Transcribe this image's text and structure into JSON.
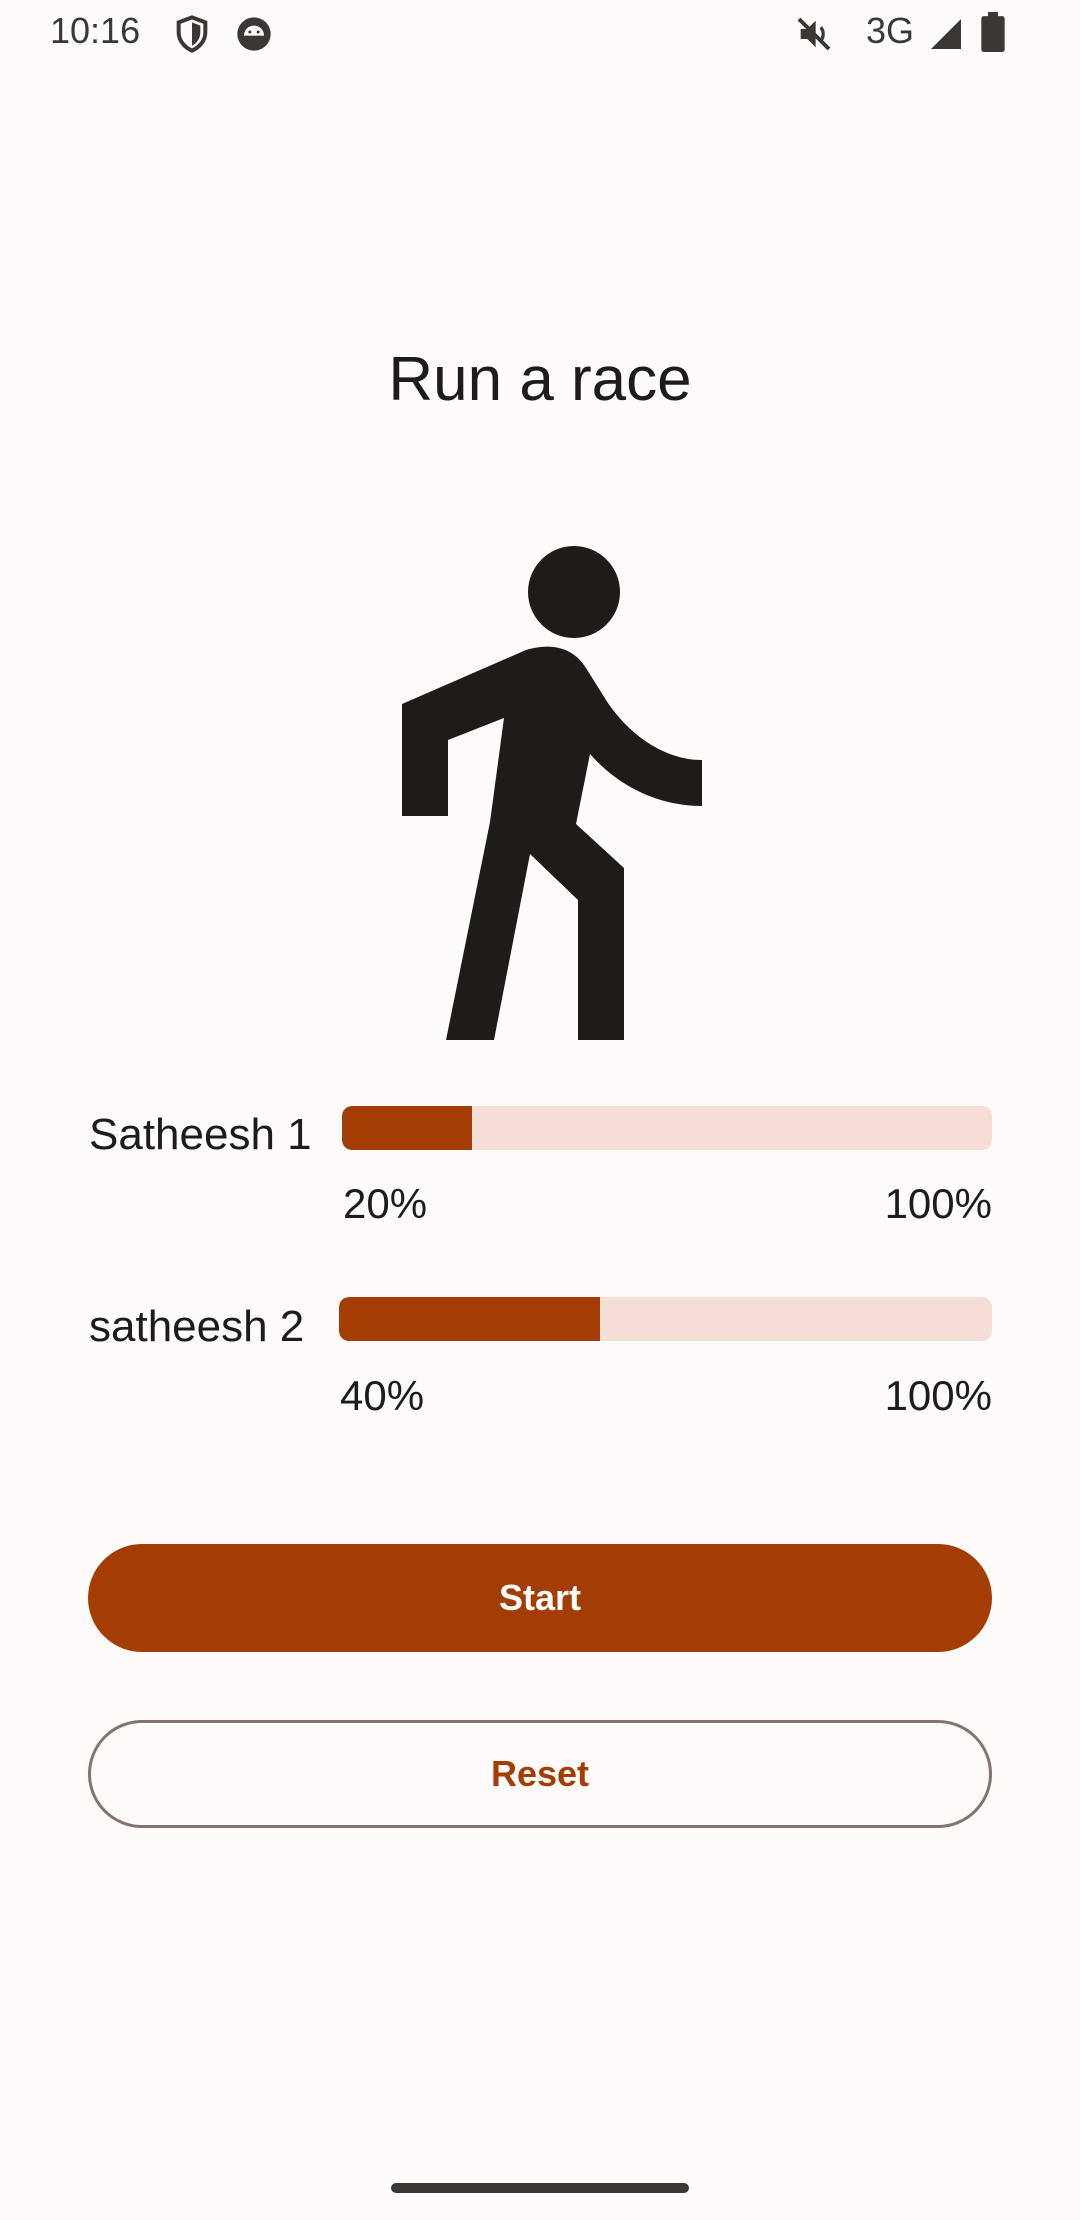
{
  "status_bar": {
    "time": "10:16",
    "network": "3G",
    "icons": [
      "shield-icon",
      "android-icon",
      "mute-icon",
      "signal-icon",
      "battery-icon"
    ]
  },
  "title": "Run a race",
  "figure_icon": "directions-walk-icon",
  "racers": [
    {
      "name": "Satheesh 1",
      "progress": 0.2,
      "progress_label": "20%",
      "max_label": "100%"
    },
    {
      "name": "satheesh 2",
      "progress": 0.4,
      "progress_label": "40%",
      "max_label": "100%"
    }
  ],
  "buttons": {
    "start_label": "Start",
    "reset_label": "Reset"
  },
  "colors": {
    "accent": "#a43d03",
    "track": "#f5ded6",
    "background": "#fffbfb",
    "outline": "#857370"
  }
}
